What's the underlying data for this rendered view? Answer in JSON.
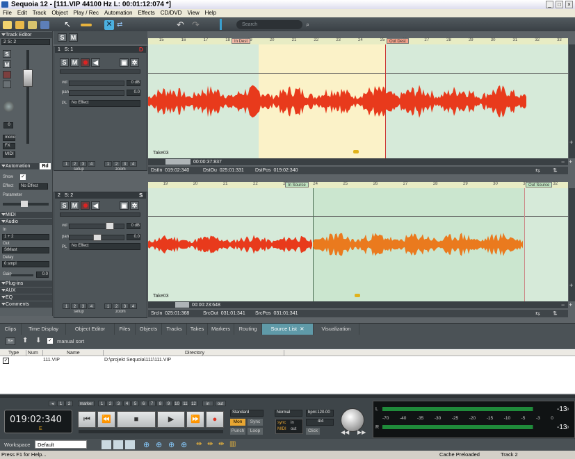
{
  "window": {
    "title": "Sequoia 12 - [111.VIP   44100 Hz L: 00:01:12:074 *]"
  },
  "menu": [
    "File",
    "Edit",
    "Track",
    "Object",
    "Play / Rec",
    "Automation",
    "Effects",
    "CD/DVD",
    "View",
    "Help"
  ],
  "toolbar": {
    "search_placeholder": "Search"
  },
  "left_panel": {
    "track_editor_label": "Track Editor",
    "track_sel": "2  S: 2",
    "mono_label": "mono",
    "fx_label": "FX",
    "midi_label": "MIDI",
    "automation_label": "Automation",
    "automation_value": "Rd",
    "show_label": "Show",
    "effect_label": "Effect",
    "effect_value": "No Effect",
    "parameter_label": "Parameter",
    "sections": [
      "MIDI",
      "Audio"
    ],
    "in_label": "In",
    "in_value": "1 + 2",
    "out_label": "Out",
    "out_value": "StMast",
    "delay_label": "Delay",
    "delay_value": "0 smpl",
    "gain_label": "Gain",
    "gain_value": "0.0",
    "lower_sections": [
      "Plug-ins",
      "AUX",
      "EQ",
      "Comments"
    ],
    "volume_display": "0"
  },
  "tracks": [
    {
      "number": "1",
      "name": "S: 1",
      "vol_label": "vol",
      "vol_value": "0 dB",
      "pan_label": "pan",
      "pan_value": "0.0",
      "pl_label": "PL",
      "effect": "No Effect",
      "take": "Take03",
      "marker1": "In Dest",
      "marker2": "Out Dest",
      "time_display": "00:00:37:837",
      "pos_fields": [
        {
          "label": "DstIn",
          "value": "019:02:340"
        },
        {
          "label": "DstOu",
          "value": "025:01:331"
        },
        {
          "label": "DstPos",
          "value": "019:02:340"
        }
      ],
      "ruler_ticks": [
        "15",
        "16",
        "17",
        "18",
        "19",
        "20",
        "21",
        "22",
        "23",
        "24",
        "25",
        "26",
        "27",
        "28",
        "29",
        "30",
        "31",
        "32",
        "33"
      ]
    },
    {
      "number": "2",
      "name": "S: 2",
      "vol_label": "vol",
      "vol_value": "0 dB",
      "pan_label": "pan",
      "pan_value": "0.0",
      "pl_label": "PL",
      "effect": "No Effect",
      "take": "Take03",
      "marker1": "In Source",
      "marker2": "Out Source",
      "time_display": "00:00:23:648",
      "pos_fields": [
        {
          "label": "SrcIn",
          "value": "025:01:368"
        },
        {
          "label": "SrcOut",
          "value": "031:01:341"
        },
        {
          "label": "SrcPos",
          "value": "031:01:341"
        }
      ],
      "ruler_ticks": [
        "19",
        "20",
        "21",
        "22",
        "23",
        "24",
        "25",
        "26",
        "27",
        "28",
        "29",
        "30",
        "31",
        "32"
      ]
    }
  ],
  "track_footer": {
    "setup_label": "setup",
    "zoom_label": "zoom",
    "nums": [
      "1",
      "2",
      "3",
      "4"
    ]
  },
  "tabs": [
    "Clips",
    "Time Display",
    "Object Editor",
    "Files",
    "Objects",
    "Tracks",
    "Takes",
    "Markers",
    "Routing",
    "Source List",
    "Visualization"
  ],
  "active_tab": "Source List",
  "source_list": {
    "manual_sort_label": "manual sort",
    "columns": [
      "Type",
      "Num",
      "Name",
      "Directory"
    ],
    "rows": [
      {
        "type": "",
        "num": "",
        "name": "111.VIP",
        "directory": "D:\\projekt Sequoia\\111\\111.VIP"
      }
    ]
  },
  "transport": {
    "time": "019:02:340",
    "time_flag": "E",
    "marker_label": "marker",
    "top_nums": [
      "1",
      "2"
    ],
    "marker_nums": [
      "1",
      "2",
      "3",
      "4",
      "5",
      "6",
      "7",
      "8",
      "9",
      "10",
      "11",
      "12"
    ],
    "in_label": "in",
    "out_label": "out",
    "mode": "Standard",
    "mon_label": "Mon",
    "sync_label": "Sync",
    "punch_label": "Punch",
    "loop_label": "Loop",
    "speed": "Normal",
    "bpm": "bpm:120.00",
    "signature": "4/4",
    "click_label": "Click",
    "sync_small": "sync",
    "midi_small": "MIDI",
    "in_small": "in",
    "out_small": "out",
    "meter_ticks": [
      "-70",
      "-40",
      "-35",
      "-30",
      "-25",
      "-20",
      "-15",
      "-10",
      "-5",
      "-3",
      "0"
    ],
    "meter_L": "-13",
    "meter_R": "-13",
    "meter_L_suffix": "ᴰ",
    "meter_R_suffix": "ᴰ"
  },
  "bottom": {
    "workspace_label": "Workspace",
    "workspace_value": "Default"
  },
  "status": {
    "help": "Press F1 for Help...",
    "cache": "Cache Preloaded",
    "track": "Track 2"
  },
  "colors": {
    "wave": "#e83a1c",
    "wave_selected": "#ea7a1e",
    "wave_bg": "#d6ead9",
    "selection": "#fbf2c8"
  }
}
